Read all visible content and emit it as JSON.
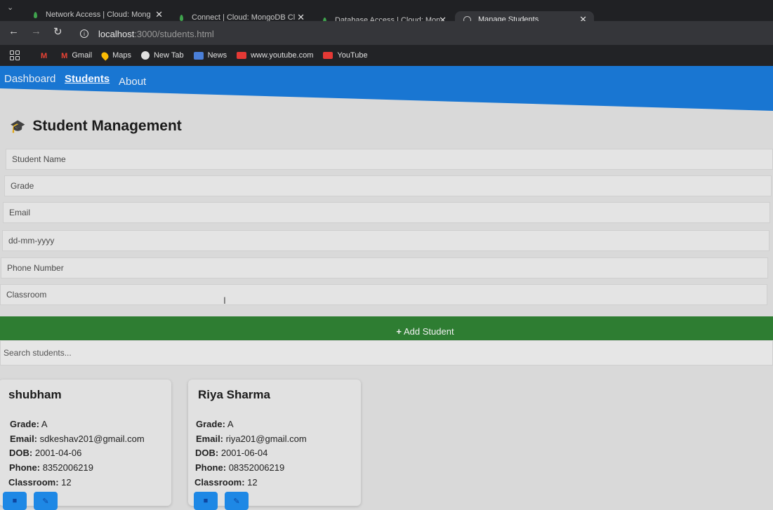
{
  "browser": {
    "tabs": [
      {
        "title": "Network Access | Cloud: Mong",
        "close": "✕"
      },
      {
        "title": "Connect | Cloud: MongoDB Cl",
        "close": "✕"
      },
      {
        "title": "Database Access | Cloud: Mon",
        "close": "✕"
      },
      {
        "title": "Manage Students",
        "close": "✕"
      }
    ],
    "new_tab": "+",
    "url_host": "localhost",
    "url_rest": ":3000/students.html",
    "bookmarks": [
      "Gmail",
      "Maps",
      "New Tab",
      "News",
      "www.youtube.com",
      "YouTube"
    ]
  },
  "nav": {
    "links": [
      "Dashboard",
      "Students",
      "About"
    ],
    "active": "Students"
  },
  "page": {
    "title": "Student Management",
    "form": {
      "name_placeholder": "Student Name",
      "grade_placeholder": "Grade",
      "email_placeholder": "Email",
      "dob_placeholder": "dd-mm-yyyy",
      "phone_placeholder": "Phone Number",
      "classroom_placeholder": "Classroom",
      "add_button": "Add Student",
      "add_icon": "+"
    },
    "search_placeholder": "Search students..."
  },
  "students": [
    {
      "name": "shubham",
      "grade": "A",
      "email": "sdkeshav201@gmail.com",
      "dob": "2001-04-06",
      "phone": "8352006219",
      "classroom": "12"
    },
    {
      "name": "Riya Sharma",
      "grade": "A",
      "email": "riya201@gmail.com",
      "dob": "2001-06-04",
      "phone": "08352006219",
      "classroom": "12"
    }
  ],
  "labels": {
    "grade": "Grade:",
    "email": "Email:",
    "dob": "DOB:",
    "phone": "Phone:",
    "classroom": "Classroom:"
  },
  "colors": {
    "navbar": "#1976d2",
    "add_button": "#2e7d32",
    "action_button": "#1e88e5"
  }
}
